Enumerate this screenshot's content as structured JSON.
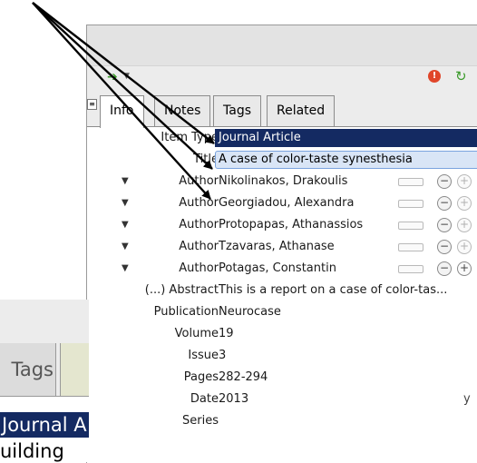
{
  "toolbar": {
    "arrow_icon": "green-right-arrow-icon",
    "error_icon_glyph": "!",
    "refresh_icon": "sync-icon"
  },
  "tabs": [
    {
      "label": "Info",
      "active": true
    },
    {
      "label": "Notes",
      "active": false
    },
    {
      "label": "Tags",
      "active": false
    },
    {
      "label": "Related",
      "active": false
    }
  ],
  "fields": {
    "item_type": {
      "label": "Item Type",
      "value": "Journal Article"
    },
    "title": {
      "label": "Title",
      "value": "A case of color-taste synesthesia"
    },
    "authors": [
      {
        "label": "Author",
        "value": "Nikolinakos, Drakoulis"
      },
      {
        "label": "Author",
        "value": "Georgiadou, Alexandra"
      },
      {
        "label": "Author",
        "value": "Protopapas, Athanassios"
      },
      {
        "label": "Author",
        "value": "Tzavaras, Athanase"
      },
      {
        "label": "Author",
        "value": "Potagas, Constantin"
      }
    ],
    "abstract": {
      "label": "(...) Abstract",
      "value": "This is a report on a case of color-tas..."
    },
    "publication": {
      "label": "Publication",
      "value": "Neurocase"
    },
    "volume": {
      "label": "Volume",
      "value": "19"
    },
    "issue": {
      "label": "Issue",
      "value": "3"
    },
    "pages": {
      "label": "Pages",
      "value": "282-294"
    },
    "date": {
      "label": "Date",
      "value": "2013",
      "suffix": "y"
    },
    "series": {
      "label": "Series",
      "value": ""
    }
  },
  "inset": {
    "tab_label": "Tags",
    "selected_text": "Journal A",
    "next_text": "uilding"
  },
  "colors": {
    "selection": "#142a62",
    "edit_bg": "#d9e5f6",
    "arrow": "#000000"
  }
}
